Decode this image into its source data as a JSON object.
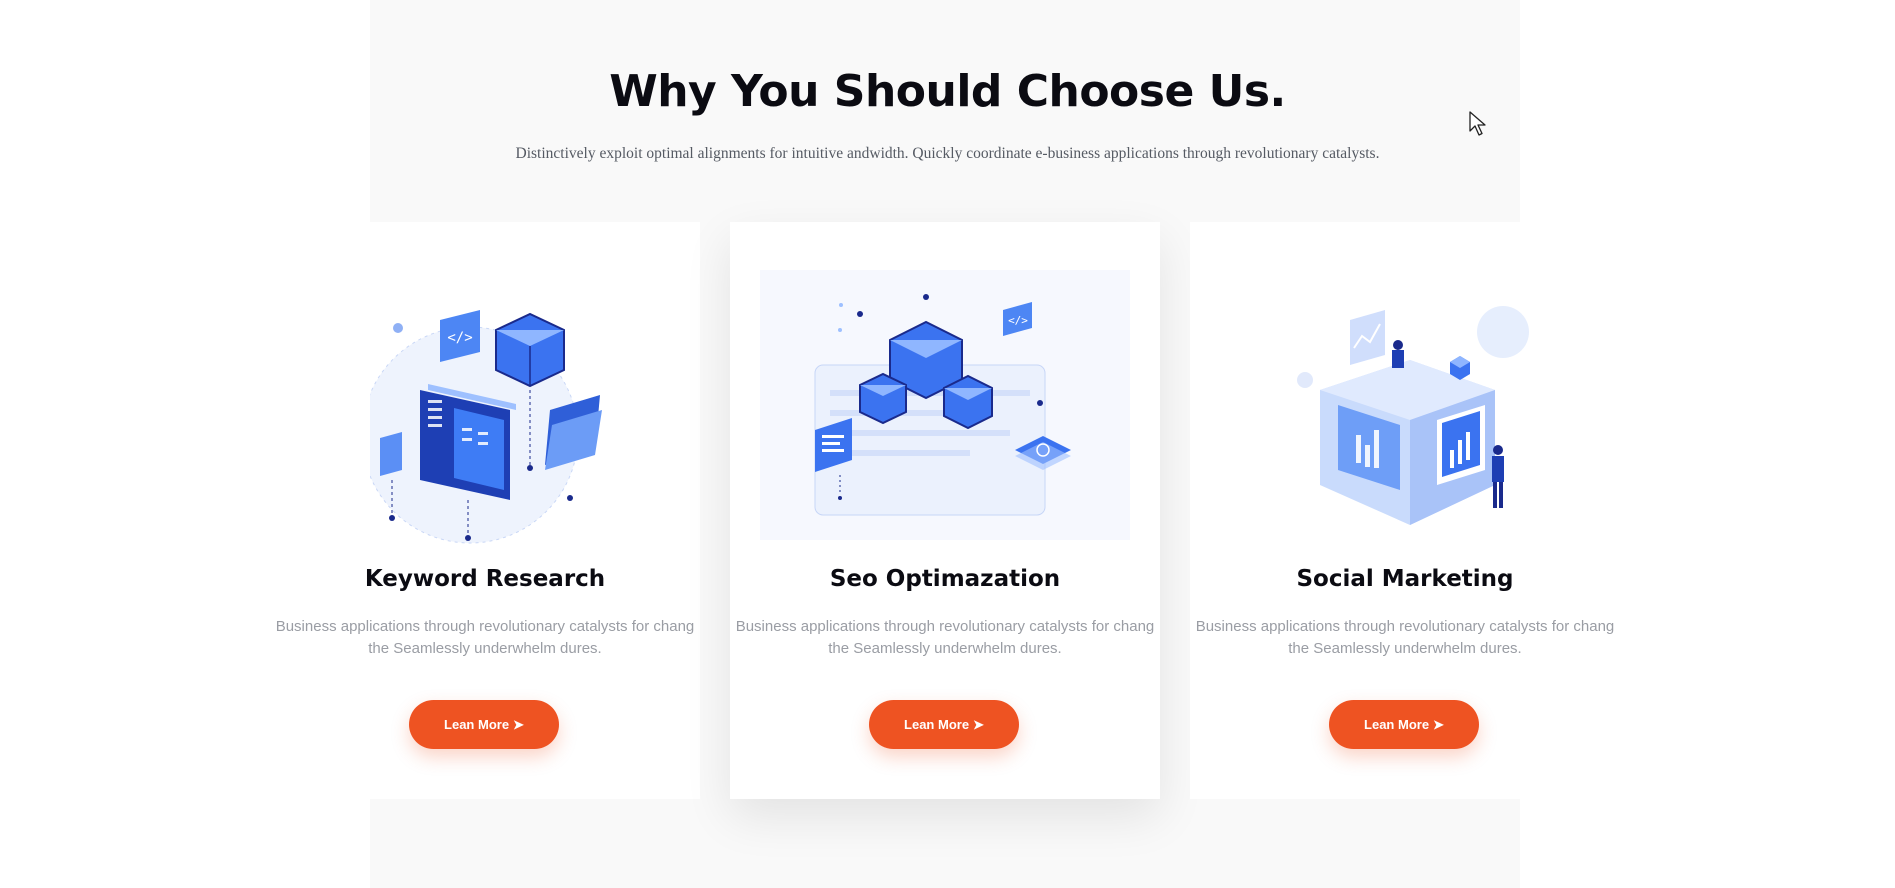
{
  "section": {
    "title": "Why You Should Choose Us.",
    "subtitle": "Distinctively exploit optimal alignments for intuitive andwidth. Quickly coordinate e-business applications through revolutionary catalysts."
  },
  "cards": [
    {
      "title": "Keyword Research",
      "description": "Business applications through revolutionary catalysts for chang the Seamlessly underwhelm dures.",
      "button_label": "Lean More",
      "button_icon": "arrow-right-icon"
    },
    {
      "title": "Seo Optimazation",
      "description": "Business applications through revolutionary catalysts for chang the Seamlessly underwhelm dures.",
      "button_label": "Lean More",
      "button_icon": "arrow-right-icon"
    },
    {
      "title": "Social Marketing",
      "description": "Business applications through revolutionary catalysts for chang the Seamlessly underwhelm dures.",
      "button_label": "Lean More",
      "button_icon": "arrow-right-icon"
    }
  ],
  "colors": {
    "accent": "#ee5322",
    "illustration_blue": "#3b73f0",
    "illustration_navy": "#1a2a8c",
    "section_background": "#f9f9f9"
  }
}
